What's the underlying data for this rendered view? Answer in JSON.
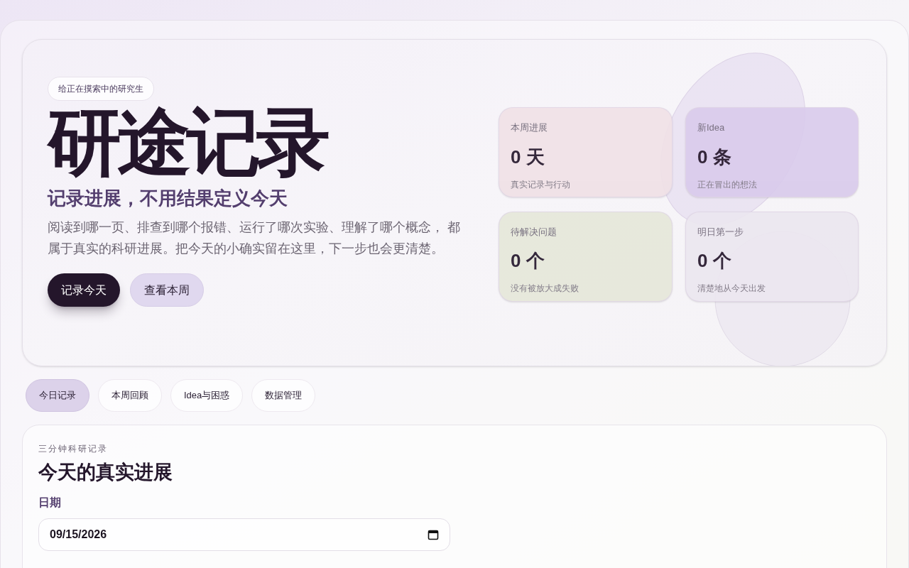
{
  "hero": {
    "badge": "给正在摸索中的研究生",
    "title": "研途记录",
    "subtitle": "记录进展，不用结果定义今天",
    "description": "阅读到哪一页、排查到哪个报错、运行了哪次实验、理解了哪个概念， 都属于真实的科研进展。把今天的小确实留在这里，下一步也会更清楚。",
    "buttons": [
      {
        "label": "记录今天",
        "kind": "primary"
      },
      {
        "label": "查看本周",
        "kind": "secondary"
      }
    ]
  },
  "stats": [
    {
      "label": "本周进展",
      "value": "0 天",
      "note": "真实记录与行动",
      "color": "#f0e1e6"
    },
    {
      "label": "新Idea",
      "value": "0 条",
      "note": "正在冒出的想法",
      "color": "#d9cbec"
    },
    {
      "label": "待解决问题",
      "value": "0 个",
      "note": "没有被放大成失败",
      "color": "#e6e8da"
    },
    {
      "label": "明日第一步",
      "value": "0 个",
      "note": "清楚地从今天出发",
      "color": "#ece7f0"
    }
  ],
  "tabs": [
    {
      "label": "今日记录",
      "selected": true
    },
    {
      "label": "本周回顾",
      "selected": false
    },
    {
      "label": "Idea与困惑",
      "selected": false
    },
    {
      "label": "数据管理",
      "selected": false
    }
  ],
  "form": {
    "eyebrow": "三分钟科研记录",
    "title": "今天的真实进展",
    "fields": [
      {
        "label": "日期",
        "value": "09/15/2026",
        "kind": "date"
      }
    ]
  }
}
